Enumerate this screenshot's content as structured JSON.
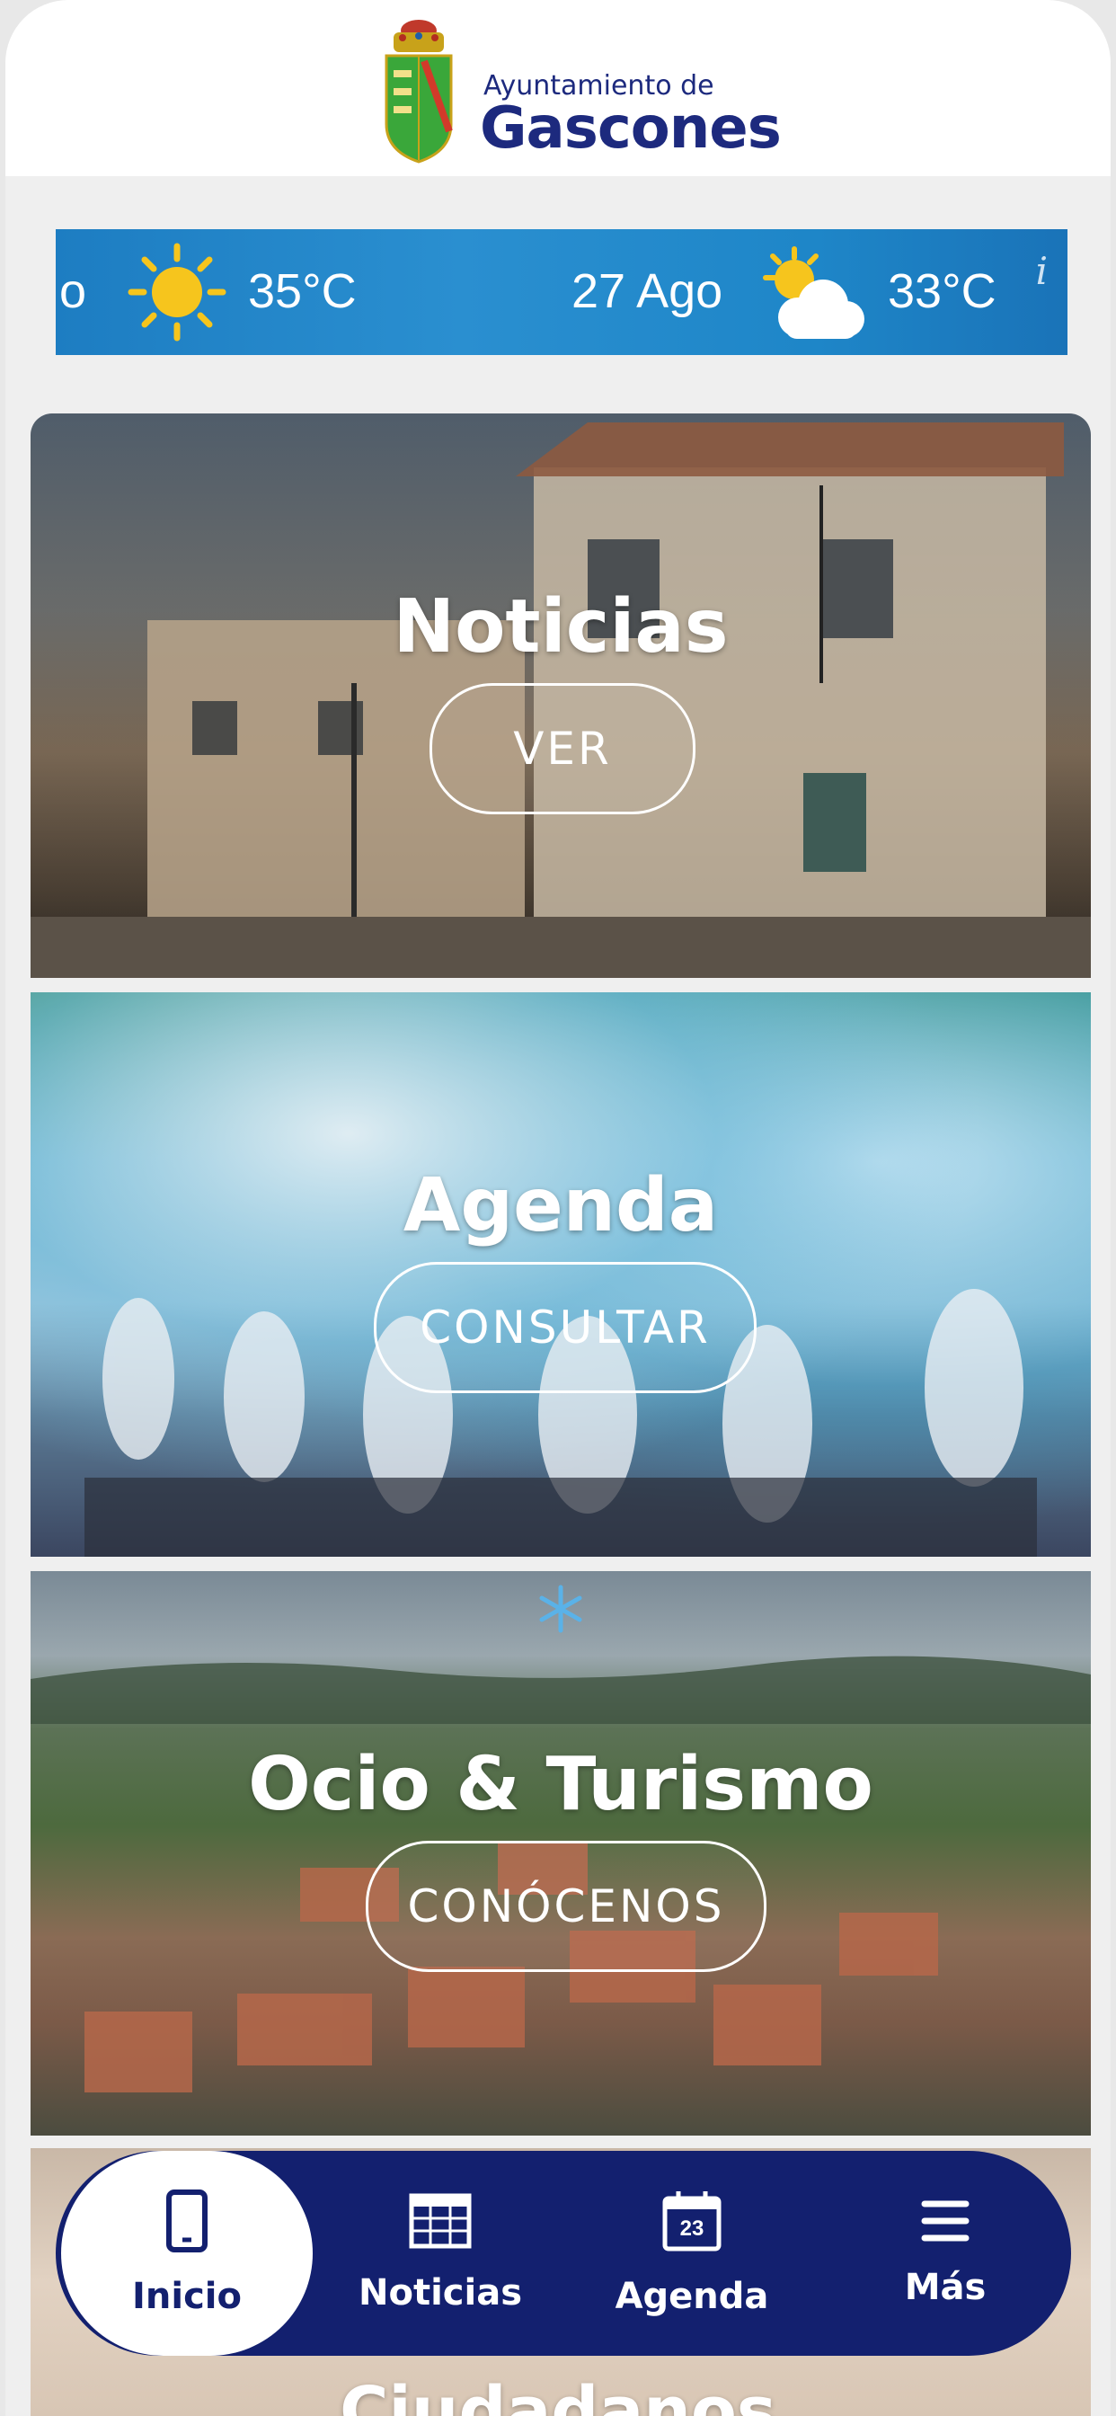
{
  "header": {
    "subtitle": "Ayuntamiento de",
    "title": "Gascones"
  },
  "weather": {
    "items": [
      {
        "day": "o",
        "icon": "sun-icon",
        "temp": "35°C"
      },
      {
        "day": "27 Ago",
        "icon": "sun-cloud-icon",
        "temp": "33°C"
      }
    ],
    "info": "i"
  },
  "cards": [
    {
      "title": "Noticias",
      "button": "VER"
    },
    {
      "title": "Agenda",
      "button": "CONSULTAR"
    },
    {
      "title": "Ocio & Turismo",
      "button": "CONÓCENOS"
    },
    {
      "title": "Ciudadanos"
    }
  ],
  "nav": {
    "items": [
      {
        "label": "Inicio",
        "icon": "phone-icon"
      },
      {
        "label": "Noticias",
        "icon": "newspaper-icon"
      },
      {
        "label": "Agenda",
        "icon": "calendar-icon",
        "icon_text": "23"
      },
      {
        "label": "Más",
        "icon": "menu-icon"
      }
    ],
    "active": "Inicio"
  },
  "colors": {
    "brand": "#1d2a7e",
    "nav_bg": "#13206f",
    "weather_bg": "#1e86c8",
    "sun": "#f6c51d"
  }
}
